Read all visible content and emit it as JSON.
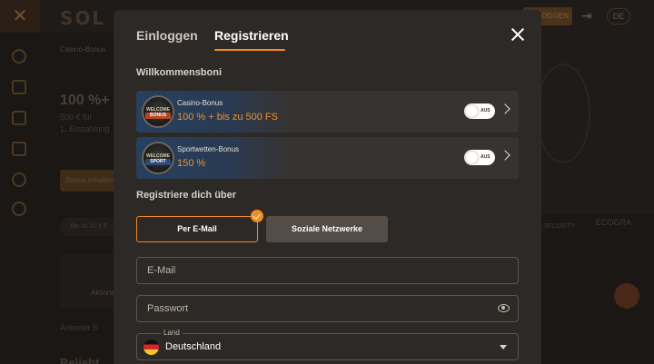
{
  "background": {
    "logo": "SOL",
    "header_login": "EINLOGGEN",
    "language": "DE",
    "tab": "Casino-Bonus",
    "promo": {
      "title": "100 %+",
      "line1": "500 € für",
      "line2": "1. Einzahlung",
      "button": "Bonus erhalten"
    },
    "pill": "Bis zu 20 € F",
    "card_label": "Aktionen",
    "tabs": "Anbieter    S",
    "bottom_title": "Beliebt",
    "right_text1": "SECURITY",
    "right_text2": "ECOGRA"
  },
  "modal": {
    "tabs": {
      "login": "Einloggen",
      "register": "Registrieren"
    },
    "welcome_label": "Willkommensboni",
    "bonuses": [
      {
        "title": "Casino-Bonus",
        "value": "100 % + bis zu 500 FS",
        "badge_text": "WELCOME",
        "badge_ribbon": "BONUS",
        "toggle_label": "AUS"
      },
      {
        "title": "Sportwetten-Bonus",
        "value": "150 %",
        "badge_text": "WELCOME",
        "badge_ribbon": "SPORT",
        "toggle_label": "AUS"
      }
    ],
    "register_via_label": "Registriere dich über",
    "methods": {
      "email": "Per E-Mail",
      "social": "Soziale Netzwerke"
    },
    "fields": {
      "email_placeholder": "E-Mail",
      "password_placeholder": "Passwort",
      "country_label": "Land",
      "country_value": "Deutschland"
    }
  },
  "colors": {
    "accent": "#f08a24",
    "modal_bg": "#2d2926",
    "page_bg": "#231f1c"
  }
}
